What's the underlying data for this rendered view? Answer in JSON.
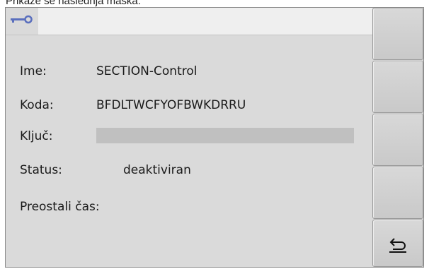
{
  "caption": "Prikaže se naslednja maska:",
  "tab": {
    "icon": "key-icon",
    "icon_color": "#5a6fbe"
  },
  "fields": {
    "name_label": "Ime:",
    "name_value": "SECTION-Control",
    "code_label": "Koda:",
    "code_value": "BFDLTWCFYOFBWKDRRU",
    "key_label": "Ključ:",
    "key_value": "",
    "status_label": "Status:",
    "status_value": "deaktiviran",
    "remaining_label": "Preostali čas:",
    "remaining_value": ""
  },
  "softkeys": [
    {
      "id": "softkey-1",
      "icon": ""
    },
    {
      "id": "softkey-2",
      "icon": ""
    },
    {
      "id": "softkey-3",
      "icon": ""
    },
    {
      "id": "softkey-4",
      "icon": ""
    },
    {
      "id": "softkey-back",
      "icon": "return-arrow-icon"
    }
  ]
}
